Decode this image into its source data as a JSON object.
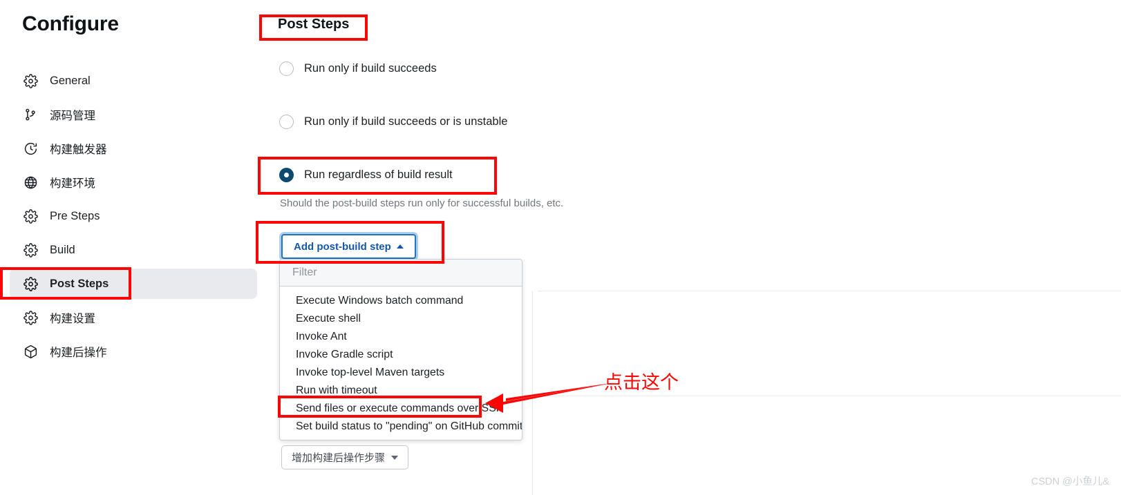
{
  "sidebar": {
    "title": "Configure",
    "items": [
      {
        "label": "General",
        "icon": "gear-icon",
        "active": false
      },
      {
        "label": "源码管理",
        "icon": "git-branch-icon",
        "active": false
      },
      {
        "label": "构建触发器",
        "icon": "clock-icon",
        "active": false
      },
      {
        "label": "构建环境",
        "icon": "globe-icon",
        "active": false
      },
      {
        "label": "Pre Steps",
        "icon": "gear-icon",
        "active": false
      },
      {
        "label": "Build",
        "icon": "gear-icon",
        "active": false
      },
      {
        "label": "Post Steps",
        "icon": "gear-icon",
        "active": true
      },
      {
        "label": "构建设置",
        "icon": "gear-icon",
        "active": false
      },
      {
        "label": "构建后操作",
        "icon": "package-icon",
        "active": false
      }
    ]
  },
  "main": {
    "page_title": "Post Steps",
    "radios": [
      {
        "label": "Run only if build succeeds",
        "checked": false
      },
      {
        "label": "Run only if build succeeds or is unstable",
        "checked": false
      },
      {
        "label": "Run regardless of build result",
        "checked": true
      }
    ],
    "helper_text": "Should the post-build steps run only for successful builds, etc.",
    "add_step_button": "Add post-build step",
    "dropdown": {
      "filter_placeholder": "Filter",
      "filter_value": "",
      "items": [
        "Execute Windows batch command",
        "Execute shell",
        "Invoke Ant",
        "Invoke Gradle script",
        "Invoke top-level Maven targets",
        "Run with timeout",
        "Send files or execute commands over SSH",
        "Set build status to \"pending\" on GitHub commit"
      ],
      "highlighted_item": "Send files or execute commands over SSH"
    },
    "bottom_button": "增加构建后操作步骤"
  },
  "annotation": {
    "text": "点击这个",
    "color": "#fb0505"
  },
  "watermark": "CSDN @小鱼儿&",
  "colors": {
    "accent_blue": "#1d72c2",
    "radio_checked": "#0d4a6f",
    "annotation_red": "#fb0505",
    "sidebar_active_bg": "#e9eaee"
  }
}
